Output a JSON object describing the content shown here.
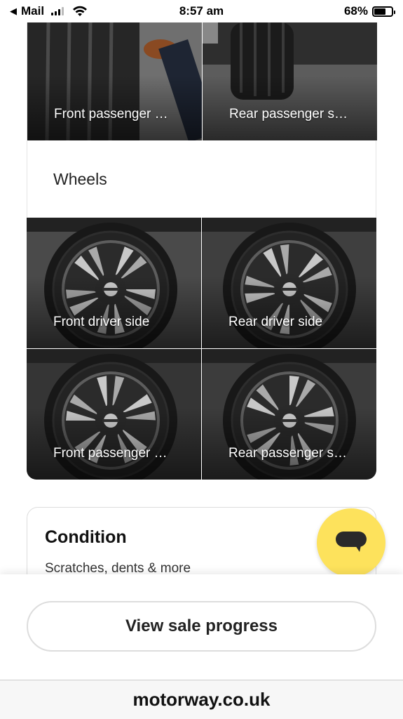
{
  "status_bar": {
    "carrier": "Mail",
    "time": "8:57 am",
    "battery_percent": "68%",
    "battery_level": 0.68
  },
  "tyres": [
    {
      "label": "Front passenger …"
    },
    {
      "label": "Rear passenger s…"
    }
  ],
  "wheels_section": {
    "title": "Wheels",
    "photos": [
      {
        "label": "Front driver side"
      },
      {
        "label": "Rear driver side"
      },
      {
        "label": "Front passenger …"
      },
      {
        "label": "Rear passenger s…"
      }
    ]
  },
  "condition": {
    "title": "Condition",
    "subtitle": "Scratches, dents & more"
  },
  "chat": {
    "icon": "chat-bubble-icon",
    "color": "#fde25c"
  },
  "cta": {
    "label": "View sale progress"
  },
  "browser": {
    "url": "motorway.co.uk"
  }
}
